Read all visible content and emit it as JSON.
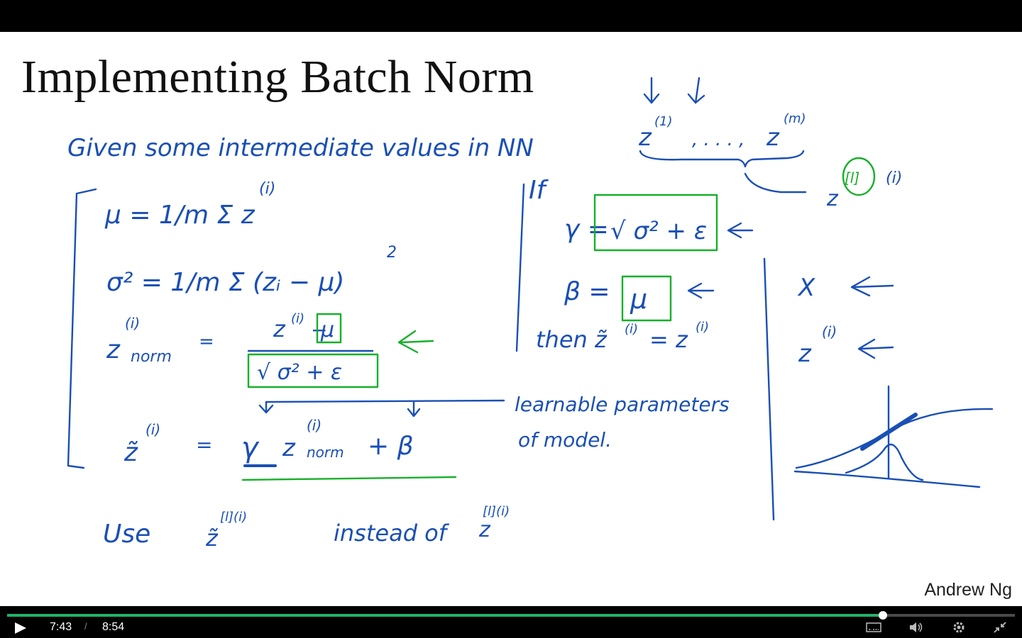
{
  "slide": {
    "title": "Implementing Batch Norm",
    "author": "Andrew Ng",
    "annotations": {
      "given_line": "Given some intermediate values in NN",
      "z_sequence_first": "z",
      "z_sequence_first_sup": "(1)",
      "z_sequence_dots": ", . . . ,",
      "z_sequence_last": "z",
      "z_sequence_last_sup": "(m)",
      "z_layer": "z",
      "z_layer_bracket": "[l]",
      "z_layer_index": "(i)",
      "mu_eq": "μ = 1/m Σ z",
      "mu_sup": "(i)",
      "sigma_eq": "σ² = 1/m Σ (zᵢ − μ)",
      "sigma_sup": "2",
      "znorm_lhs": "z",
      "znorm_lhs_sup": "(i)",
      "znorm_lhs_sub": "norm",
      "znorm_eq": "=",
      "znorm_numerator": "z",
      "znorm_numerator_sup": "(i)",
      "znorm_minus": "−",
      "znorm_mu_boxed": "μ",
      "znorm_denominator": "√ σ² + ε",
      "ztilde_lhs": "z̃",
      "ztilde_sup": "(i)",
      "ztilde_eq": "=",
      "ztilde_gamma": "γ",
      "ztilde_z": "z",
      "ztilde_z_sup": "(i)",
      "ztilde_z_sub": "norm",
      "ztilde_plus": "+ β",
      "learnable_line1": "learnable parameters",
      "learnable_line2": "of model.",
      "if_label": "If",
      "if_gamma": "γ =",
      "if_gamma_boxed": "√ σ² + ε",
      "if_beta": "β =",
      "if_beta_boxed": "μ",
      "then_text": "then z̃",
      "then_sup": "(i)",
      "then_eq": "= z",
      "then_eq_sup": "(i)",
      "use_text": "Use",
      "use_z": "z̃",
      "use_sup": "[l](i)",
      "instead_of": "instead of",
      "instead_z": "z",
      "instead_sup": "[l](i)",
      "x_label": "X",
      "z_label": "z",
      "z_label_sup": "(i)"
    }
  },
  "player": {
    "current_time": "7:43",
    "separator": "/",
    "total_time": "8:54",
    "progress": 0.8687,
    "progress_color": "#1fb36b",
    "icons": [
      "play-icon",
      "captions-icon",
      "volume-icon",
      "settings-icon",
      "exit-fullscreen-icon"
    ]
  },
  "colors": {
    "ink_blue": "#1a4fb5",
    "ink_green": "#17b02a"
  }
}
